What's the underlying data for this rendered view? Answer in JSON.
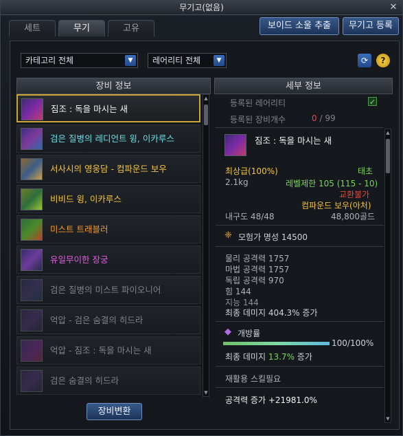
{
  "window": {
    "title": "무기고(없음)",
    "close_icon": "close-icon"
  },
  "tabs": [
    {
      "label": "세트",
      "active": false
    },
    {
      "label": "무기",
      "active": true
    },
    {
      "label": "고유",
      "active": false
    }
  ],
  "buttons": {
    "void_soul_extract": "보이드 소울 추출",
    "arsenal_register": "무기고 등록",
    "equip_convert": "장비변환"
  },
  "filters": {
    "category": "카테고리 전체",
    "rarity": "레어리티 전체"
  },
  "icons": {
    "refresh": "refresh-icon",
    "help": "?"
  },
  "left_header": "장비 정보",
  "right_header": "세부 정보",
  "items": [
    {
      "name": "짐조 : 독을 마시는 새",
      "color": "#f2f2f2",
      "selected": true
    },
    {
      "name": "검은 질병의 레디언트 윙, 이카루스",
      "color": "#67e0e6",
      "selected": false
    },
    {
      "name": "서사시의 영웅담 - 컴파운드 보우",
      "color": "#f4c542",
      "selected": false
    },
    {
      "name": "비비드 윙, 이카루스",
      "color": "#f4c542",
      "selected": false
    },
    {
      "name": "미스트 트래블러",
      "color": "#f39a2d",
      "selected": false
    },
    {
      "name": "유일무이한 장궁",
      "color": "#e25ce2",
      "selected": false
    },
    {
      "name": "검은 질병의 미스트 파이오니어",
      "color": "#7e838a",
      "selected": false
    },
    {
      "name": "억압 - 검은 숨결의 히드라",
      "color": "#7e838a",
      "selected": false
    },
    {
      "name": "억압 - 짐조 : 독을 마시는 새",
      "color": "#7e838a",
      "selected": false
    },
    {
      "name": "검은 숨결의 히드라",
      "color": "#7e838a",
      "selected": false
    }
  ],
  "detail": {
    "registered_rarity_label": "등록된 레어리티",
    "registered_count_label": "등록된 장비개수",
    "registered_count_current": "0",
    "registered_count_sep": " / 99",
    "item_name": "짐조 : 독을 마시는 새",
    "grade": "최상급(100%)",
    "element": "태초",
    "weight": "2.1kg",
    "level_limit": "레벨제한 105 (115 - 10)",
    "trade": "교환불가",
    "weapon_type": "컴파운드 보우(아처)",
    "durability": "내구도 48/48",
    "price": "48,800골드",
    "fame": "모험가 명성 14500",
    "stats": [
      "물리 공격력 1757",
      "마법 공격력 1757",
      "독립 공격력 970",
      "힘 144",
      "지능 144"
    ],
    "final_damage": "최종 데미지 404.3% 증가",
    "rupture_label": "개방률",
    "rupture_value": "100/100%",
    "rupture_progress": 1.0,
    "final_damage2_label": "최종 데미지 ",
    "final_damage2_value": "13.7%",
    "final_damage2_suffix": " 증가",
    "reuse_skill": "재활용 스킬필요",
    "attack_increase": "공격력 증가 +21981.0%"
  }
}
